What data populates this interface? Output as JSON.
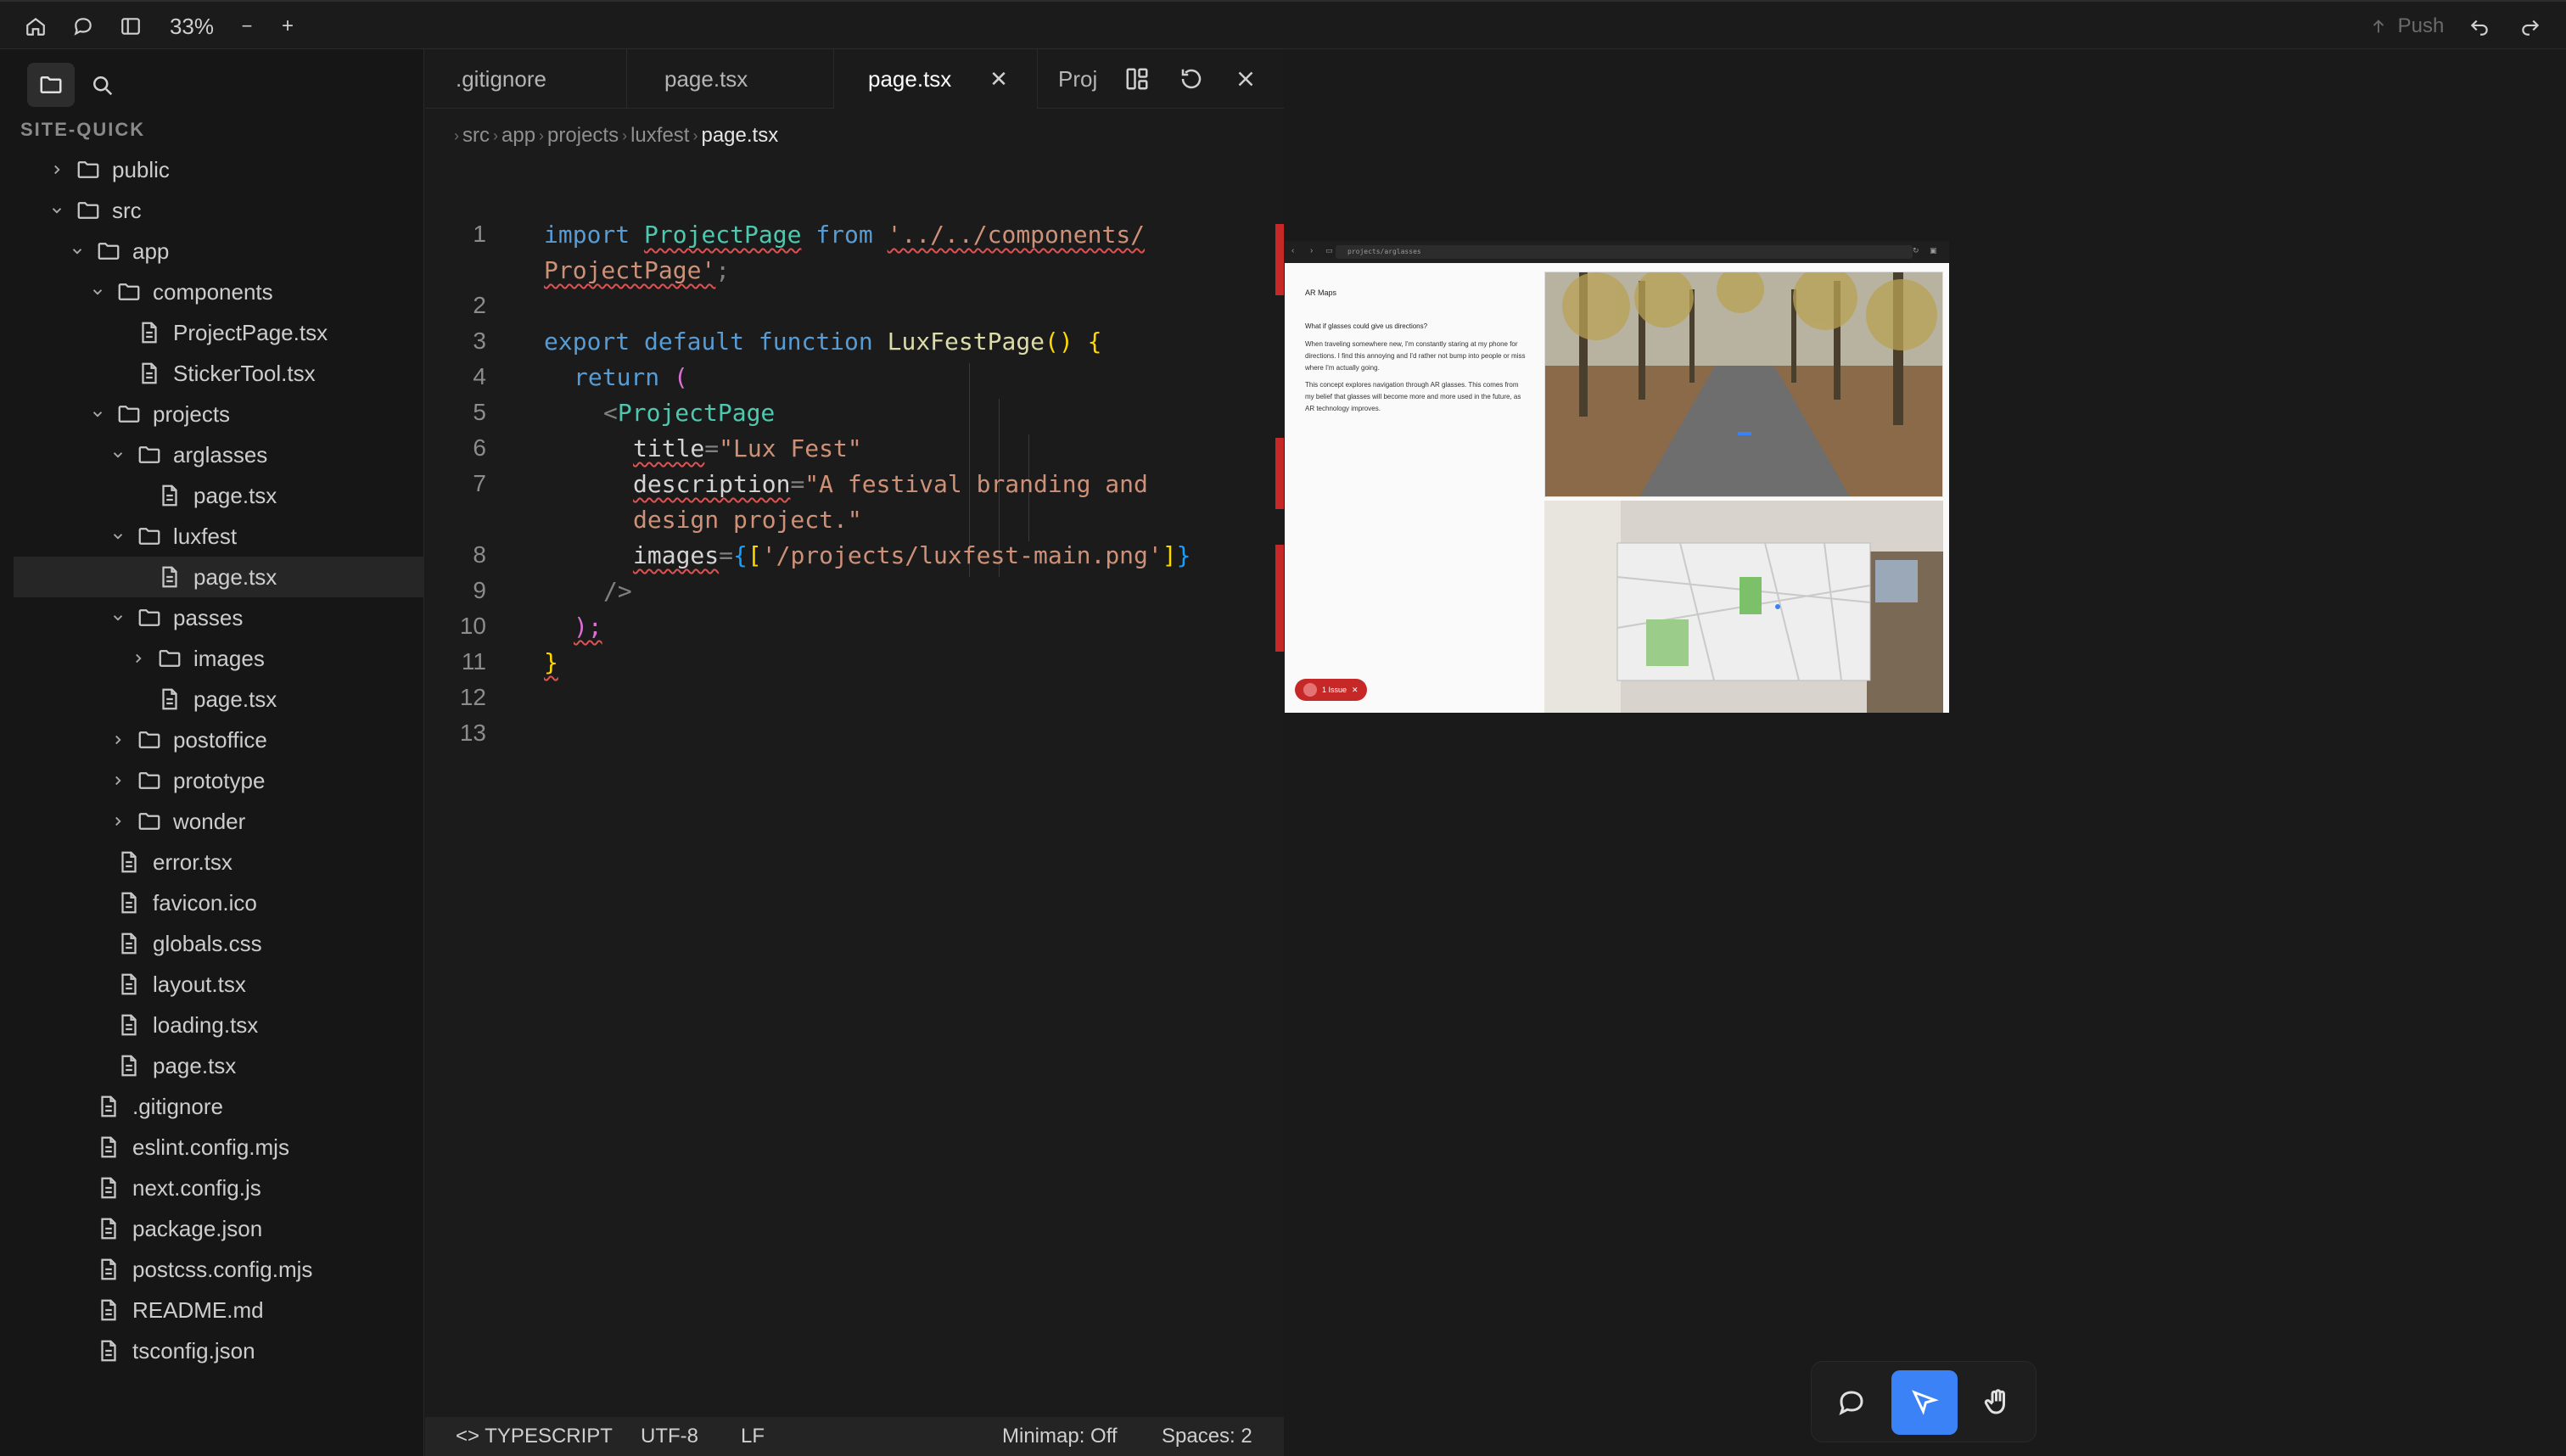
{
  "topbar": {
    "zoom": "33%",
    "zoom_out": "−",
    "zoom_in": "+",
    "push_label": "Push"
  },
  "sidebar": {
    "project_name": "SITE-QUICK",
    "tree": [
      {
        "label": "public",
        "type": "folder",
        "depth": 1,
        "expanded": false
      },
      {
        "label": "src",
        "type": "folder",
        "depth": 1,
        "expanded": true
      },
      {
        "label": "app",
        "type": "folder",
        "depth": 2,
        "expanded": true
      },
      {
        "label": "components",
        "type": "folder",
        "depth": 3,
        "expanded": true
      },
      {
        "label": "ProjectPage.tsx",
        "type": "file",
        "depth": 4
      },
      {
        "label": "StickerTool.tsx",
        "type": "file",
        "depth": 4
      },
      {
        "label": "projects",
        "type": "folder",
        "depth": 3,
        "expanded": true
      },
      {
        "label": "arglasses",
        "type": "folder",
        "depth": 4,
        "expanded": true
      },
      {
        "label": "page.tsx",
        "type": "file",
        "depth": 5
      },
      {
        "label": "luxfest",
        "type": "folder",
        "depth": 4,
        "expanded": true
      },
      {
        "label": "page.tsx",
        "type": "file",
        "depth": 5,
        "selected": true
      },
      {
        "label": "passes",
        "type": "folder",
        "depth": 4,
        "expanded": true
      },
      {
        "label": "images",
        "type": "folder",
        "depth": 5,
        "expanded": false
      },
      {
        "label": "page.tsx",
        "type": "file",
        "depth": 5
      },
      {
        "label": "postoffice",
        "type": "folder",
        "depth": 4,
        "expanded": false
      },
      {
        "label": "prototype",
        "type": "folder",
        "depth": 4,
        "expanded": false
      },
      {
        "label": "wonder",
        "type": "folder",
        "depth": 4,
        "expanded": false
      },
      {
        "label": "error.tsx",
        "type": "file",
        "depth": 3
      },
      {
        "label": "favicon.ico",
        "type": "file",
        "depth": 3
      },
      {
        "label": "globals.css",
        "type": "file",
        "depth": 3
      },
      {
        "label": "layout.tsx",
        "type": "file",
        "depth": 3
      },
      {
        "label": "loading.tsx",
        "type": "file",
        "depth": 3
      },
      {
        "label": "page.tsx",
        "type": "file",
        "depth": 3
      },
      {
        "label": ".gitignore",
        "type": "file",
        "depth": 2
      },
      {
        "label": "eslint.config.mjs",
        "type": "file",
        "depth": 2
      },
      {
        "label": "next.config.js",
        "type": "file",
        "depth": 2
      },
      {
        "label": "package.json",
        "type": "file",
        "depth": 2
      },
      {
        "label": "postcss.config.mjs",
        "type": "file",
        "depth": 2
      },
      {
        "label": "README.md",
        "type": "file",
        "depth": 2
      },
      {
        "label": "tsconfig.json",
        "type": "file",
        "depth": 2
      }
    ]
  },
  "editor": {
    "tabs": [
      {
        "label": ".gitignore",
        "active": false
      },
      {
        "label": "page.tsx",
        "active": false
      },
      {
        "label": "page.tsx",
        "active": true
      },
      {
        "label": "Proje",
        "active": false
      }
    ],
    "breadcrumb": [
      "src",
      "app",
      "projects",
      "luxfest",
      "page.tsx"
    ],
    "line_numbers": [
      "1",
      "2",
      "3",
      "4",
      "5",
      "6",
      "7",
      "8",
      "9",
      "10",
      "11",
      "12",
      "13"
    ],
    "code": {
      "l1a_kw": "import",
      "l1a_cls": "ProjectPage",
      "l1a_from": "from",
      "l1a_str": "'../../components/",
      "l1b_str": "ProjectPage'",
      "l1b_semi": ";",
      "l3_export": "export",
      "l3_default": "default",
      "l3_function": "function",
      "l3_name": "LuxFestPage",
      "l3_parens": "()",
      "l3_brace": "{",
      "l4_return": "return",
      "l4_paren": "(",
      "l5_lt": "<",
      "l5_tag": "ProjectPage",
      "l6_attr": "title",
      "l6_eq": "=",
      "l6_val": "\"Lux Fest\"",
      "l7a_attr": "description",
      "l7a_eq": "=",
      "l7a_val": "\"A festival branding and",
      "l7b_val": "design project.\"",
      "l8_attr": "images",
      "l8_eq": "=",
      "l8_ob": "{",
      "l8_arr_open": "[",
      "l8_val": "'/projects/luxfest-main.png'",
      "l8_arr_close": "]",
      "l8_cb": "}",
      "l9_close": "/>",
      "l10_paren": ");",
      "l11_brace": "}"
    },
    "status": {
      "language": "TYPESCRIPT",
      "encoding": "UTF-8",
      "eol": "LF",
      "minimap": "Minimap: Off",
      "spaces": "Spaces: 2"
    }
  },
  "preview": {
    "url": "projects/arglasses",
    "title": "AR Maps",
    "question": "What if glasses could give us directions?",
    "paragraph1": "When traveling somewhere new, I'm constantly staring at my phone for directions. I find this annoying and I'd rather not bump into people or miss where I'm actually going.",
    "paragraph2": "This concept explores navigation through AR glasses. This comes from my belief that glasses will become more and more used in the future, as AR technology improves.",
    "issue_label": "1 Issue"
  },
  "colors": {
    "accent": "#3b82f6",
    "error": "#c62828",
    "keyword": "#569cd6",
    "type": "#4ec9b0",
    "string": "#ce9178",
    "function": "#dcdcaa"
  }
}
